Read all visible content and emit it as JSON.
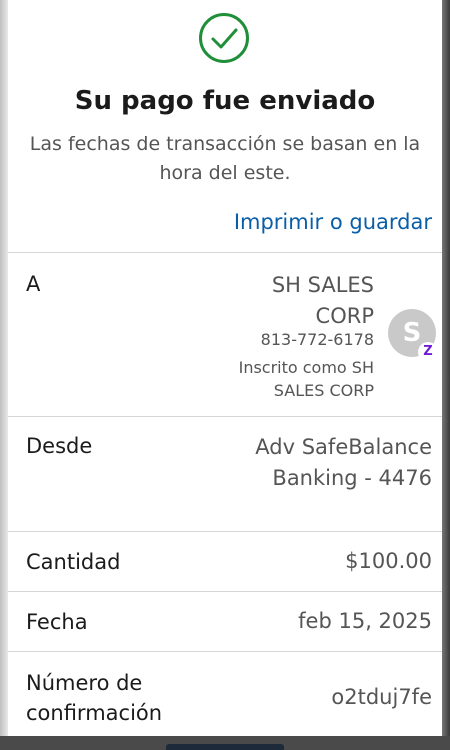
{
  "header": {
    "check_icon": "check-circle-icon",
    "title": "Su pago fue enviado",
    "subtitle": "Las fechas de transacción se basan en la hora del este.",
    "print_link": "Imprimir o guardar"
  },
  "colors": {
    "success_green": "#1f8f3a",
    "link_blue": "#0a5ea8",
    "zelle_purple": "#6d1ed4"
  },
  "details": {
    "to": {
      "label": "A",
      "name": "SH SALES CORP",
      "phone": "813-772-6178",
      "enrolled": "Inscrito como SH SALES CORP",
      "avatar_letter": "S",
      "badge_letter": "Z"
    },
    "from": {
      "label": "Desde",
      "value": "Adv SafeBalance Banking - 4476"
    },
    "amount": {
      "label": "Cantidad",
      "value": "$100.00"
    },
    "date": {
      "label": "Fecha",
      "value": "feb 15, 2025"
    },
    "confirmation": {
      "label": "Número de confirmación",
      "value": "o2tduj7fe"
    }
  }
}
